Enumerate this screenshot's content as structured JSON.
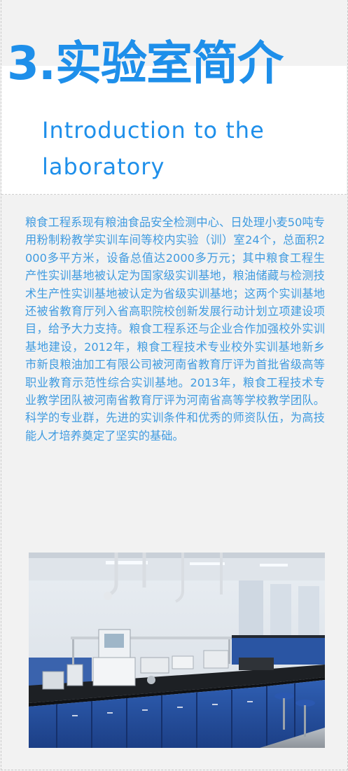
{
  "section": {
    "title": "3.实验室简介",
    "subtitle": "Introduction to the laboratory"
  },
  "body": {
    "paragraph": "粮食工程系现有粮油食品安全检测中心、日处理小麦50吨专用粉制粉教学实训车间等校内实验（训）室24个，总面积2000多平方米，设备总值达2000多万元；其中粮食工程生产性实训基地被认定为国家级实训基地，粮油储藏与检测技术生产性实训基地被认定为省级实训基地；这两个实训基地还被省教育厅列入省高职院校创新发展行动计划立项建设项目，给予大力支持。粮食工程系还与企业合作加强校外实训基地建设，2012年，粮食工程技术专业校外实训基地新乡市新良粮油加工有限公司被河南省教育厅评为首批省级高等职业教育示范性综合实训基地。2013年，粮食工程技术专业教学团队被河南省教育厅评为河南省高等学校教学团队。科学的专业群，先进的实训条件和优秀的师资队伍，为高技能人才培养奠定了坚实的基础。"
  },
  "colors": {
    "accent": "#1e8fea",
    "body_text": "#3f9be0",
    "background": "#f2f2f2",
    "header_band": "#ffffff"
  }
}
